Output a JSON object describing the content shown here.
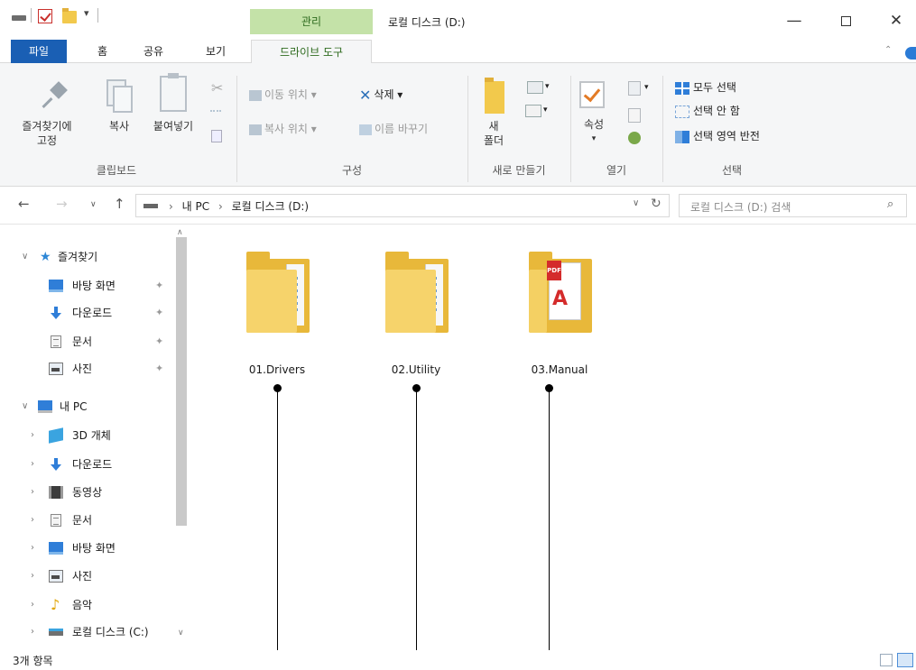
{
  "window": {
    "title": "로컬 디스크 (D:)",
    "context_tab_header": "관리",
    "quick_access_dropdown": "▾",
    "minimize": "—",
    "close": "✕"
  },
  "ribbon_tabs": {
    "file": "파일",
    "home": "홈",
    "share": "공유",
    "view": "보기",
    "drive_tools": "드라이브 도구",
    "collapse": "⌃"
  },
  "ribbon": {
    "clipboard": {
      "label": "클립보드",
      "pin_to_quick_access": "즐겨찾기에\n고정",
      "copy": "복사",
      "paste": "붙여넣기"
    },
    "organize": {
      "label": "구성",
      "move_to": "이동 위치 ▾",
      "delete": "삭제 ▾",
      "copy_to": "복사 위치 ▾",
      "rename": "이름 바꾸기"
    },
    "new": {
      "label": "새로 만들기",
      "new_folder": "새\n폴더",
      "new_item_drop": "▾",
      "easy_access_drop": "▾"
    },
    "open": {
      "label": "열기",
      "properties": "속성",
      "properties_drop": "▾",
      "open_drop": "▾"
    },
    "select": {
      "label": "선택",
      "select_all": "모두 선택",
      "select_none": "선택 안 함",
      "invert_selection": "선택 영역 반전"
    }
  },
  "address": {
    "back": "←",
    "forward": "→",
    "recent": "∨",
    "up": "↑",
    "path": [
      "내 PC",
      "로컬 디스크 (D:)"
    ],
    "path_separator": "›",
    "dropdown": "∨",
    "refresh": "↻"
  },
  "search": {
    "placeholder": "로컬 디스크 (D:) 검색",
    "icon": "⌕"
  },
  "nav_pane": {
    "quick_access": "즐겨찾기",
    "quick_items": [
      "바탕 화면",
      "다운로드",
      "문서",
      "사진"
    ],
    "this_pc": "내 PC",
    "pc_items": [
      "3D 개체",
      "다운로드",
      "동영상",
      "문서",
      "바탕 화면",
      "사진",
      "음악",
      "로컬 디스크 (C:)"
    ],
    "expand_open": "∨",
    "expand_closed": "›",
    "pin": "✦",
    "scroll_up": "∧",
    "scroll_down": "∨"
  },
  "files": [
    {
      "name": "01.Drivers",
      "icon": "folder-icon"
    },
    {
      "name": "02.Utility",
      "icon": "folder-icon"
    },
    {
      "name": "03.Manual",
      "icon": "pdf-folder-icon"
    }
  ],
  "pdf_badge": "PDF",
  "pdf_logo": "A",
  "status": {
    "item_count": "3개 항목"
  }
}
